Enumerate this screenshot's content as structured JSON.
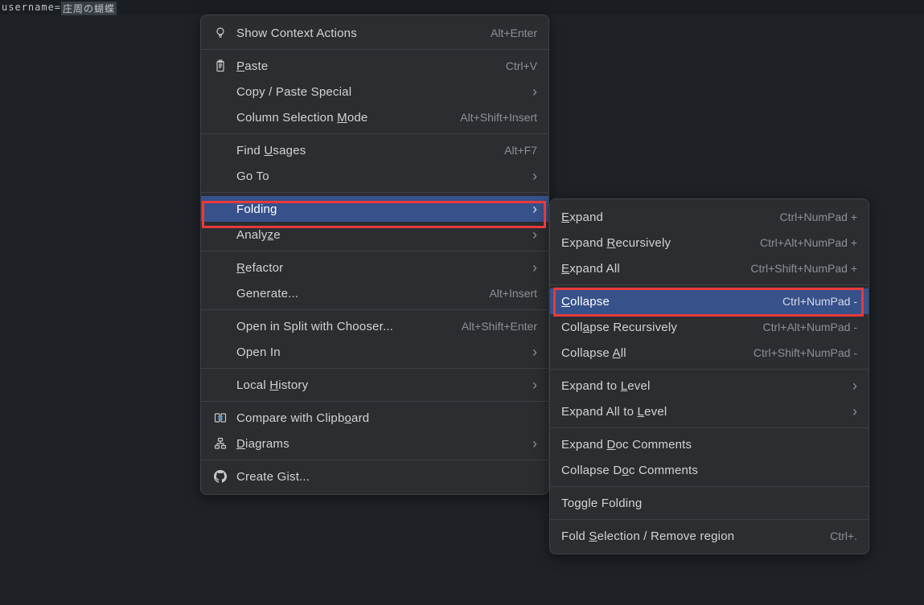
{
  "editor": {
    "key": "username=",
    "value": "庄周の蝴蝶"
  },
  "main_menu": {
    "items": [
      {
        "label": "Show Context Actions",
        "shortcut": "Alt+Enter",
        "icon": "bulb"
      },
      {
        "divider": true
      },
      {
        "label": "Paste",
        "u": 0,
        "shortcut": "Ctrl+V",
        "icon": "clipboard"
      },
      {
        "label": "Copy / Paste Special",
        "arrow": true,
        "noicon": true
      },
      {
        "label": "Column Selection Mode",
        "u": 17,
        "shortcut": "Alt+Shift+Insert",
        "noicon": true
      },
      {
        "divider": true
      },
      {
        "label": "Find Usages",
        "u": 5,
        "shortcut": "Alt+F7",
        "noicon": true
      },
      {
        "label": "Go To",
        "arrow": true,
        "noicon": true
      },
      {
        "divider": true
      },
      {
        "label": "Folding",
        "arrow": true,
        "noicon": true,
        "hl": true
      },
      {
        "label": "Analyze",
        "u": 5,
        "arrow": true,
        "noicon": true
      },
      {
        "divider": true
      },
      {
        "label": "Refactor",
        "u": 0,
        "arrow": true,
        "noicon": true
      },
      {
        "label": "Generate...",
        "shortcut": "Alt+Insert",
        "noicon": true
      },
      {
        "divider": true
      },
      {
        "label": "Open in Split with Chooser...",
        "shortcut": "Alt+Shift+Enter",
        "noicon": true
      },
      {
        "label": "Open In",
        "arrow": true,
        "noicon": true
      },
      {
        "divider": true
      },
      {
        "label": "Local History",
        "u": 6,
        "arrow": true,
        "noicon": true
      },
      {
        "divider": true
      },
      {
        "label": "Compare with Clipboard",
        "u": 18,
        "icon": "compare"
      },
      {
        "label": "Diagrams",
        "u": 0,
        "arrow": true,
        "icon": "diagram"
      },
      {
        "divider": true
      },
      {
        "label": "Create Gist...",
        "icon": "github"
      }
    ]
  },
  "sub_menu": {
    "items": [
      {
        "label": "Expand",
        "u": 0,
        "shortcut": "Ctrl+NumPad +"
      },
      {
        "label": "Expand Recursively",
        "u": 7,
        "shortcut": "Ctrl+Alt+NumPad +"
      },
      {
        "label": "Expand All",
        "u": 0,
        "shortcut": "Ctrl+Shift+NumPad +"
      },
      {
        "divider": true
      },
      {
        "label": "Collapse",
        "u": 0,
        "shortcut": "Ctrl+NumPad -",
        "hl": true
      },
      {
        "label": "Collapse Recursively",
        "u": 4,
        "shortcut": "Ctrl+Alt+NumPad -"
      },
      {
        "label": "Collapse All",
        "u": 9,
        "shortcut": "Ctrl+Shift+NumPad -"
      },
      {
        "divider": true
      },
      {
        "label": "Expand to Level",
        "u": 10,
        "arrow": true
      },
      {
        "label": "Expand All to Level",
        "u": 14,
        "arrow": true
      },
      {
        "divider": true
      },
      {
        "label": "Expand Doc Comments",
        "u": 7
      },
      {
        "label": "Collapse Doc Comments",
        "u": 10
      },
      {
        "divider": true
      },
      {
        "label": "Toggle Folding"
      },
      {
        "divider": true
      },
      {
        "label": "Fold Selection / Remove region",
        "u": 5,
        "shortcut": "Ctrl+."
      }
    ]
  }
}
